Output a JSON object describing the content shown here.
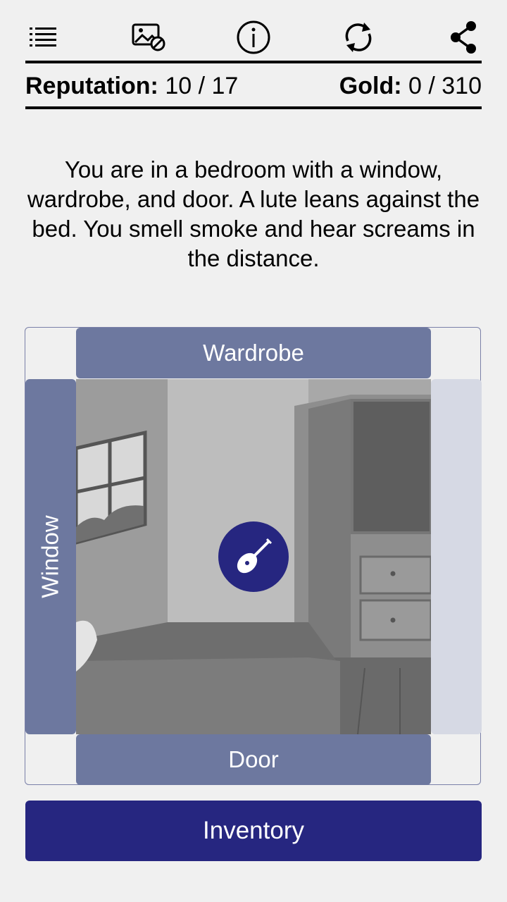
{
  "toolbar": {
    "icons": [
      "list-icon",
      "image-off-icon",
      "info-icon",
      "refresh-icon",
      "share-icon"
    ]
  },
  "stats": {
    "reputation_label": "Reputation:",
    "reputation_value": "10 / 17",
    "gold_label": "Gold:",
    "gold_value": "0 / 310"
  },
  "narration": "You are in a bedroom with a window, wardrobe, and door. A lute leans against the bed. You smell smoke and hear screams in the distance.",
  "exits": {
    "top": "Wardrobe",
    "left": "Window",
    "bottom": "Door"
  },
  "scene": {
    "item_icon": "lute-icon"
  },
  "inventory_label": "Inventory",
  "colors": {
    "exit": "#6d789f",
    "exit_disabled": "#d6d9e4",
    "accent": "#262680",
    "background": "#f0f0f0"
  }
}
